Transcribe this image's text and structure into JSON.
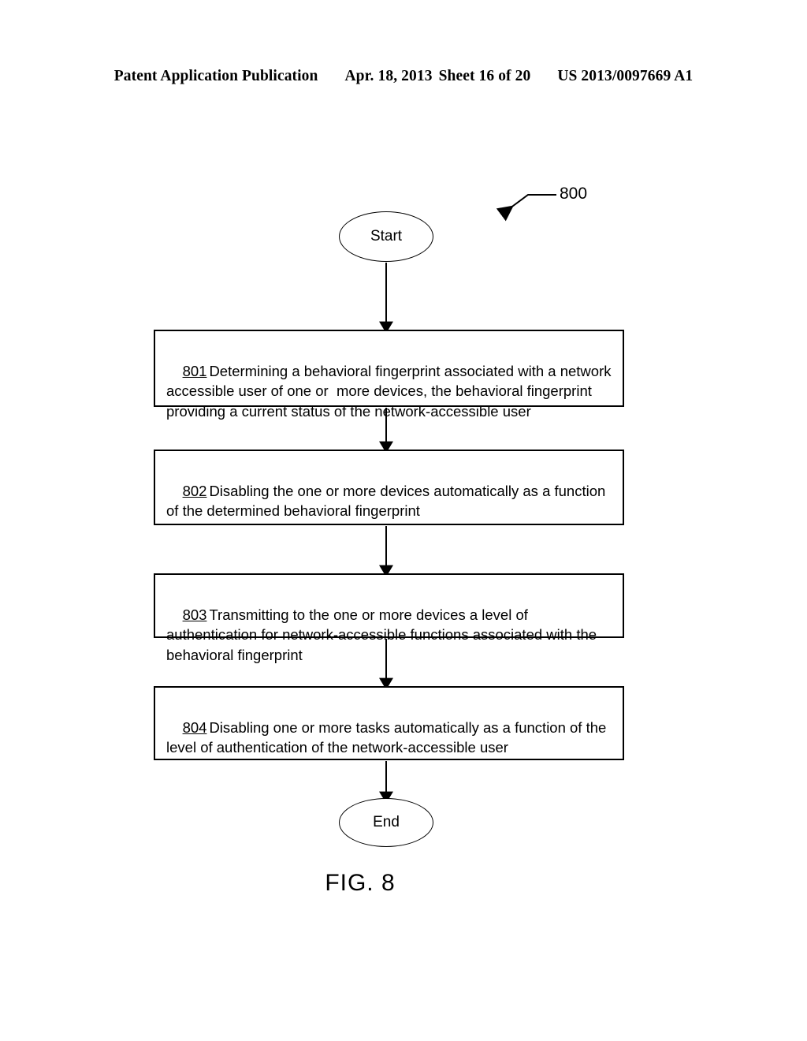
{
  "header": {
    "publication": "Patent Application Publication",
    "date": "Apr. 18, 2013",
    "sheet": "Sheet 16 of 20",
    "doc_number": "US 2013/0097669 A1"
  },
  "figure": {
    "reference_numeral": "800",
    "caption": "FIG. 8",
    "start_label": "Start",
    "end_label": "End",
    "steps": [
      {
        "number": "801",
        "text": "Determining a behavioral fingerprint associated with a network accessible user of one or  more devices, the behavioral fingerprint providing a current status of the network-accessible user"
      },
      {
        "number": "802",
        "text": "Disabling the one or more devices automatically as a function of the determined behavioral fingerprint"
      },
      {
        "number": "803",
        "text": "Transmitting to the one or more devices a level of authentication for network-accessible functions associated with the behavioral fingerprint"
      },
      {
        "number": "804",
        "text": "Disabling one or more tasks automatically as a function of the level of authentication of the network-accessible user"
      }
    ]
  },
  "colors": {
    "ink": "#000000",
    "paper": "#ffffff"
  }
}
